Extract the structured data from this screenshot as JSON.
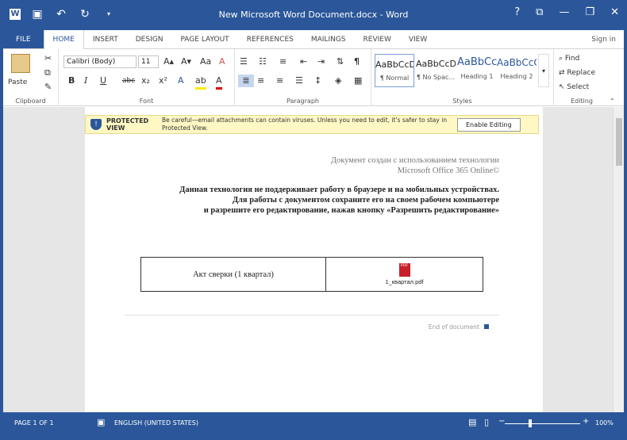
{
  "titlebar": {
    "title": "New Microsoft Word Document.docx - Word",
    "help": "?",
    "ribbon_opts": "⧉",
    "minimize": "—",
    "restore": "❐",
    "close": "✕"
  },
  "tabs": [
    "FILE",
    "HOME",
    "INSERT",
    "DESIGN",
    "PAGE LAYOUT",
    "REFERENCES",
    "MAILINGS",
    "REVIEW",
    "VIEW"
  ],
  "sign_in": "Sign in",
  "ribbon": {
    "clipboard": {
      "paste": "Paste",
      "label": "Clipboard"
    },
    "font": {
      "family": "Calibri (Body)",
      "size": "11",
      "label": "Font"
    },
    "paragraph": {
      "label": "Paragraph"
    },
    "styles": {
      "label": "Styles",
      "items": [
        {
          "sample": "AaBbCcDd",
          "name": "¶ Normal"
        },
        {
          "sample": "AaBbCcDd",
          "name": "¶ No Spac..."
        },
        {
          "sample": "AaBbCc",
          "name": "Heading 1"
        },
        {
          "sample": "AaBbCcC",
          "name": "Heading 2"
        }
      ]
    },
    "editing": {
      "find": "Find",
      "replace": "Replace",
      "select": "Select",
      "label": "Editing"
    }
  },
  "protected_view": {
    "title": "PROTECTED VIEW",
    "message": "Be careful—email attachments can contain viruses. Unless you need to edit, it's safer to stay in Protected View.",
    "button": "Enable Editing"
  },
  "document": {
    "line1": "Документ создан с использованием технологии",
    "line2": "Microsoft Office 365 Online©",
    "line3": "Данная технология не поддерживает  работу в браузере и на мобильных устройствах.",
    "line4": "Для работы с документом сохраните его на своем рабочем компьютере",
    "line5": "и разрешите его редактирование, нажав кнопку «Разрешить редактирование»",
    "table_cell": "Акт сверки (1 квартал)",
    "attachment": "1_квартал.pdf",
    "end_marker": "End of document"
  },
  "status": {
    "page": "PAGE 1 OF 1",
    "language": "ENGLISH (UNITED STATES)",
    "zoom": "100%"
  },
  "colors": {
    "accent": "#2b579a",
    "protected_bg": "#fff8c5"
  }
}
